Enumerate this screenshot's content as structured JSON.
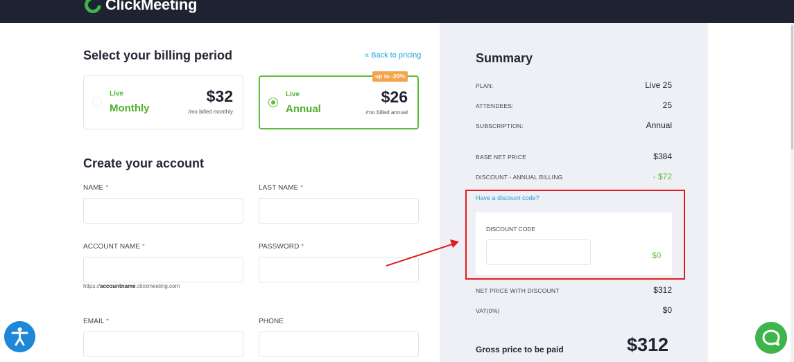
{
  "header": {
    "logo_text": "ClickMeeting"
  },
  "billing": {
    "title": "Select your billing period",
    "back_link": "« Back to pricing",
    "discount_badge": "up to -20%",
    "plans": [
      {
        "tag": "Live",
        "name": "Monthly",
        "price": "$32",
        "note": "/mo billed monthly",
        "selected": false
      },
      {
        "tag": "Live",
        "name": "Annual",
        "price": "$26",
        "note": "/mo billed annual",
        "selected": true
      }
    ]
  },
  "account": {
    "title": "Create your account",
    "fields": {
      "name": "NAME",
      "last_name": "LAST NAME",
      "account_name": "ACCOUNT NAME",
      "password": "PASSWORD",
      "email": "EMAIL",
      "phone": "PHONE"
    },
    "required_mark": "*",
    "url_hint_prefix": "https://",
    "url_hint_name": "accountname",
    "url_hint_suffix": ".clickmeeting.com"
  },
  "summary": {
    "title": "Summary",
    "rows": [
      {
        "key": "PLAN:",
        "value": "Live 25"
      },
      {
        "key": "ATTENDEES:",
        "value": "25"
      },
      {
        "key": "SUBSCRIPTION:",
        "value": "Annual"
      },
      {
        "key": "BASE NET PRICE",
        "value": "$384"
      },
      {
        "key": "DISCOUNT - ANNUAL BILLING",
        "value": "- $72"
      },
      {
        "key": "NET PRICE WITH DISCOUNT",
        "value": "$312"
      },
      {
        "key": "VAT(0%)",
        "value": "$0"
      }
    ],
    "have_code_link": "Have a discount code?",
    "code_label": "DISCOUNT CODE",
    "code_amount": "$0",
    "gross_label": "Gross price to be paid",
    "gross_value": "$312"
  },
  "colors": {
    "brand_green": "#5bbd3a",
    "link_blue": "#1fa0d8",
    "highlight_red": "#e11c1c",
    "topbar": "#1f2230"
  },
  "icons": {
    "accessibility": "accessibility-icon",
    "chat": "chat-bubble-icon"
  }
}
